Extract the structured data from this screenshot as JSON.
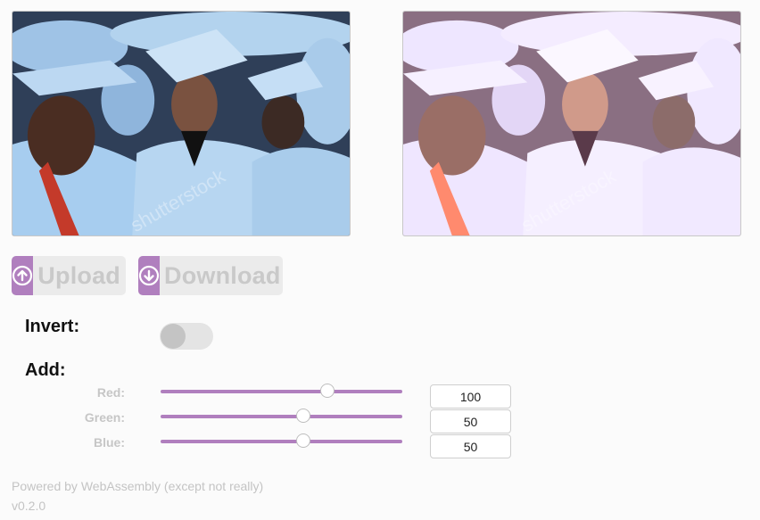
{
  "images": {
    "original": {
      "watermark": "shutterstock"
    },
    "processed": {
      "watermark": "shutterstock"
    }
  },
  "buttons": {
    "upload": {
      "label": "Upload",
      "icon": "upload-arrow-icon"
    },
    "download": {
      "label": "Download",
      "icon": "download-arrow-icon"
    }
  },
  "invert": {
    "label": "Invert:",
    "enabled": false
  },
  "add": {
    "label": "Add:",
    "channels": [
      {
        "label": "Red:",
        "value": "100",
        "slider_fraction": 0.69
      },
      {
        "label": "Green:",
        "value": "50",
        "slider_fraction": 0.59
      },
      {
        "label": "Blue:",
        "value": "50",
        "slider_fraction": 0.59
      }
    ]
  },
  "footer": {
    "powered": "Powered by WebAssembly (except not really)",
    "version": "v0.2.0"
  },
  "colors": {
    "accent": "#b07fbe"
  }
}
